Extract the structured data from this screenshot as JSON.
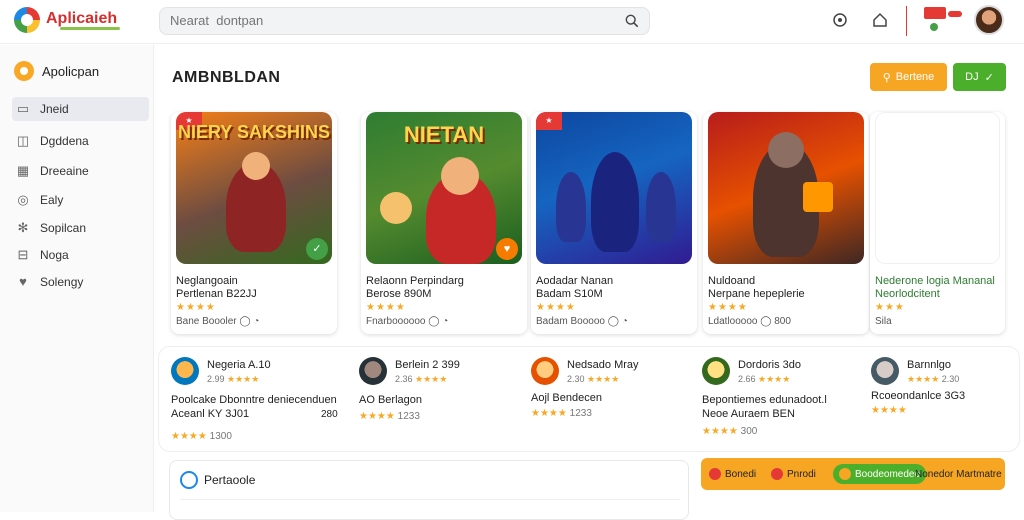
{
  "app": {
    "brand": "Aplicaieh"
  },
  "search": {
    "placeholder": "Nearat  dontpan"
  },
  "sidebar": {
    "title": "Apolicpan",
    "items": [
      {
        "label": "Jneid",
        "icon": "file-icon",
        "active": true
      },
      {
        "label": "Dgddena",
        "icon": "shopping-bag-icon"
      },
      {
        "label": "Dreeaine",
        "icon": "grid-icon"
      },
      {
        "label": "Ealy",
        "icon": "globe-icon"
      },
      {
        "label": "Sopilcan",
        "icon": "settings-icon"
      },
      {
        "label": "Noga",
        "icon": "cart-icon"
      },
      {
        "label": "Solengy",
        "icon": "heart-icon"
      }
    ]
  },
  "main": {
    "title": "AMBNBLDAN",
    "primary_button": "Bertene",
    "secondary_button": "DJ"
  },
  "cards": [
    {
      "game_title": "NIERY SAKSHINS",
      "name_line1": "Neglangoain",
      "name_line2": "Pertlenan B22JJ",
      "stars": "★★★★",
      "meta": "Bane Boooler  ◯  ◔",
      "badge_color": "#43a047",
      "bg": "linear-gradient(160deg,#f57f17,#6d4c41 55%,#33691e)"
    },
    {
      "game_title": "NIETAN",
      "name_line1": "Relaonn Perpindarg",
      "name_line2": "Berose 890M",
      "stars": "★★★★",
      "meta": "Fnarboooooo  ◯  ◔",
      "badge_color": "#f57c00",
      "bg": "linear-gradient(160deg,#2e7d32,#558b2f 50%,#1b5e20)"
    },
    {
      "game_title": "",
      "name_line1": "Aodadar Nanan",
      "name_line2": "Badam S10M",
      "stars": "★★★★",
      "meta": "Badam Booooo  ◯  ◔",
      "badge_color": "",
      "bg": "linear-gradient(160deg,#0d47a1,#1565c0 45%,#311b92)"
    },
    {
      "game_title": "",
      "name_line1": "Nuldoand",
      "name_line2": "Nerpane hepeplerie",
      "stars": "★★★★",
      "meta": "Ldatlooooo  ◯  800",
      "badge_color": "",
      "bg": "linear-gradient(160deg,#b71c1c,#e65100 50%,#3e2723)"
    },
    {
      "game_title": "",
      "name_line1": "Nederone logia Mananal",
      "name_line2": "Neorlodcitent",
      "stars": "★★★",
      "meta": "Sila",
      "badge_color": "",
      "bg": "#ffffff"
    }
  ],
  "reviews": [
    {
      "name": "Negeria A.10",
      "stars": "★★★★",
      "rating": "2.99",
      "text_line1": "Poolcake Dbonntre deniecenduen",
      "text_line2": "Aceanl KY 3J01",
      "side_value": "280",
      "foot_stars": "★★★★",
      "foot_value": "1300"
    },
    {
      "name": "Berlein 2 399",
      "stars": "★★★★",
      "rating": "2.36",
      "text_line1": "AO Berlagon",
      "text_line2": "",
      "side_value": "",
      "foot_stars": "★★★★",
      "foot_value": "1233"
    },
    {
      "name": "Nedsado Mray",
      "stars": "★★★★",
      "rating": "2.30",
      "text_line1": "Aojl Bendecen",
      "text_line2": "",
      "side_value": "",
      "foot_stars": "★★★★",
      "foot_value": "1233"
    },
    {
      "name": "Dordoris 3do",
      "stars": "★★★★",
      "rating": "2.66",
      "text_line1": "Bepontiemes edunadoot.l",
      "text_line2": "Neoe Auraem BEN",
      "side_value": "",
      "foot_stars": "★★★★",
      "foot_value": "300"
    },
    {
      "name": "Barnnlgo",
      "stars": "★★★★",
      "rating": "2.30",
      "text_line1": "Rcoeondanlce 3G3",
      "text_line2": "",
      "side_value": "",
      "foot_stars": "★★★★",
      "foot_value": ""
    }
  ],
  "panel": {
    "title": "Pertaoole"
  },
  "filters": {
    "chip1": "Bonedi",
    "chip2": "Pnrodi",
    "chip3": "Boodeomedeo",
    "chip4": "Nonedor Martmatre"
  },
  "colors": {
    "accent_orange": "#f6a623",
    "accent_green": "#4caf2b",
    "star": "#f9a825",
    "brand_red": "#d32f2f"
  }
}
